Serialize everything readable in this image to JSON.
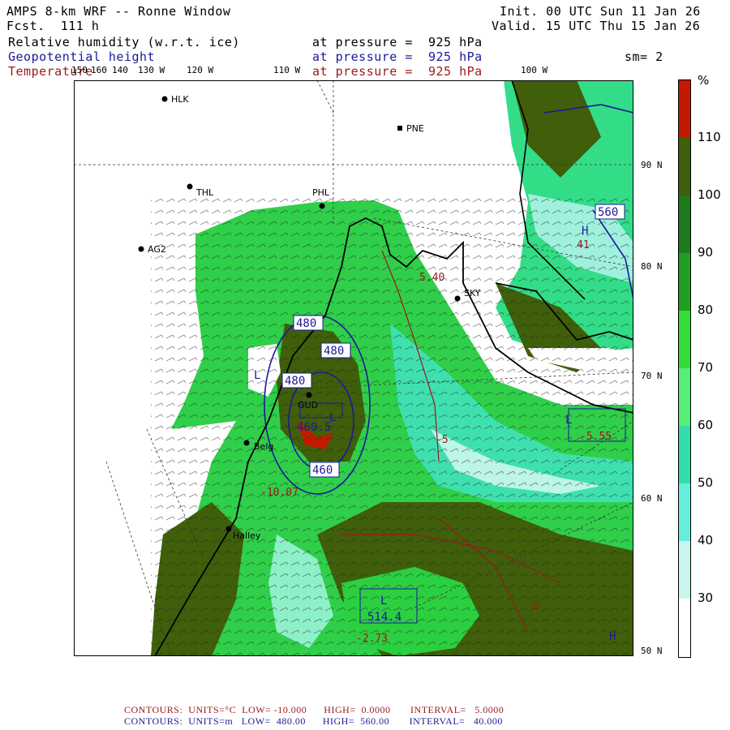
{
  "header": {
    "title": "AMPS 8-km WRF -- Ronne Window",
    "fcst": "Fcst.  111 h",
    "init": "Init. 00 UTC Sun 11 Jan 26",
    "valid": "Valid. 15 UTC Thu 15 Jan 26",
    "fields": [
      {
        "name": "Relative humidity (w.r.t. ice)",
        "level": "at pressure =  925 hPa",
        "color": "#000000"
      },
      {
        "name": "Geopotential height",
        "level": "at pressure =  925 hPa",
        "color": "#1a1a9a"
      },
      {
        "name": "Temperature",
        "level": "at pressure =  925 hPa",
        "color": "#9a1a1a"
      }
    ],
    "sm": "sm= 2"
  },
  "longitude_labels": [
    "150",
    "160",
    "140",
    "130 W",
    "120 W",
    "110 W",
    "100 W"
  ],
  "latitude_labels": [
    "90 N",
    "80 N",
    "70 N",
    "60 N",
    "50 N"
  ],
  "stations": [
    "HLK",
    "PNE",
    "THL",
    "PHL",
    "AG2",
    "SKY",
    "GUD",
    "Belg",
    "Halley"
  ],
  "map_labels": {
    "h_contours": [
      "560",
      "480",
      "480",
      "480",
      "460",
      "460.5",
      "460",
      "514.4"
    ],
    "t_values": [
      "5.40",
      "-10.07",
      "-2.73",
      "-5",
      "-5",
      "41",
      "-5.55"
    ],
    "highs_lows": [
      "H",
      "L",
      "L",
      "L",
      "H",
      "L"
    ]
  },
  "colorbar": {
    "unit": "%",
    "ticks": [
      "110",
      "100",
      "90",
      "80",
      "70",
      "60",
      "50",
      "40",
      "30"
    ],
    "colors": [
      "#c21a00",
      "#3f5f0a",
      "#1d7a1d",
      "#20a020",
      "#33dd33",
      "#55ee77",
      "#33ddaa",
      "#66eedd",
      "#c8f5ee",
      "#ffffff"
    ]
  },
  "footer": {
    "line1": "CONTOURS:  UNITS=°C  LOW= -10.000      HIGH=  0.0000       INTERVAL=   5.0000",
    "line2": "CONTOURS:  UNITS=m   LOW=  480.00      HIGH=  560.00       INTERVAL=   40.000"
  }
}
